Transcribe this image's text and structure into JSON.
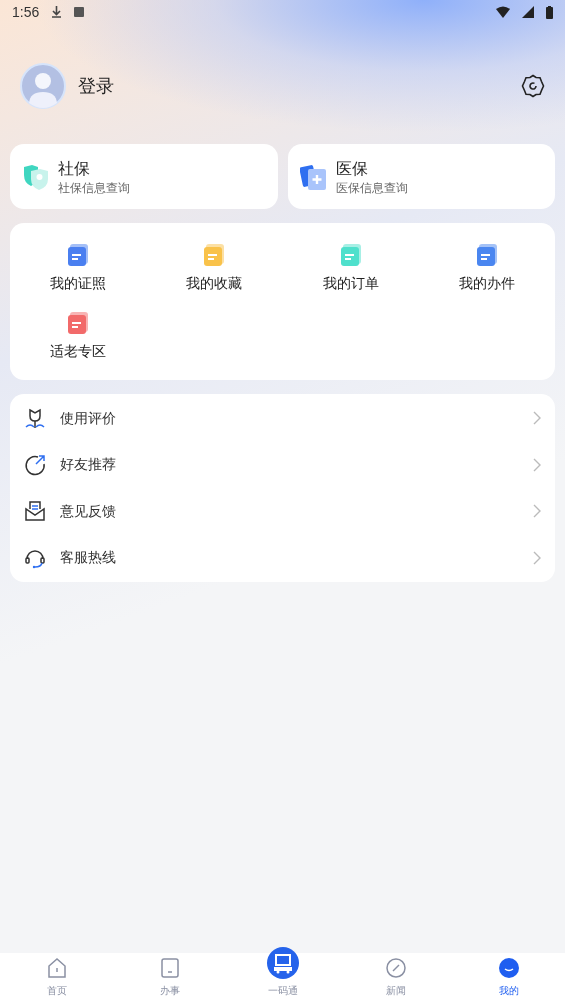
{
  "status_bar": {
    "time": "1:56"
  },
  "profile": {
    "login_label": "登录"
  },
  "service_cards": [
    {
      "title": "社保",
      "subtitle": "社保信息查询",
      "color": "#3fd6c0"
    },
    {
      "title": "医保",
      "subtitle": "医保信息查询",
      "color": "#2f6ff0"
    }
  ],
  "shortcuts": [
    {
      "label": "我的证照",
      "color": "#4a7ff0"
    },
    {
      "label": "我的收藏",
      "color": "#f9c24a"
    },
    {
      "label": "我的订单",
      "color": "#4fe0cc"
    },
    {
      "label": "我的办件",
      "color": "#4a86f0"
    },
    {
      "label": "适老专区",
      "color": "#f26a6a"
    }
  ],
  "menu": [
    {
      "label": "使用评价"
    },
    {
      "label": "好友推荐"
    },
    {
      "label": "意见反馈"
    },
    {
      "label": "客服热线"
    }
  ],
  "bottom_nav": [
    {
      "label": "首页",
      "kind": "tab",
      "selected": false
    },
    {
      "label": "办事",
      "kind": "tab",
      "selected": false
    },
    {
      "label": "一码通",
      "kind": "center",
      "selected": false
    },
    {
      "label": "新闻",
      "kind": "tab",
      "selected": false
    },
    {
      "label": "我的",
      "kind": "tab",
      "selected": true
    }
  ]
}
